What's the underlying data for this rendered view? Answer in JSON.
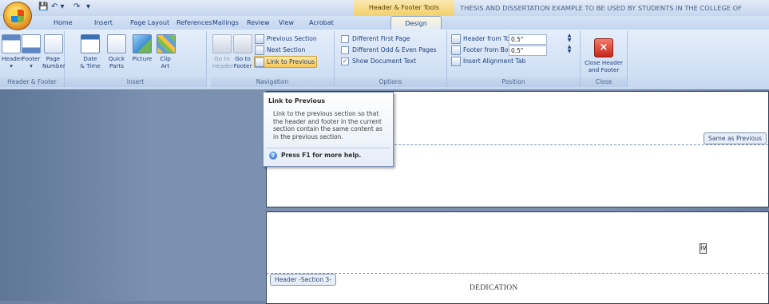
{
  "window": {
    "contextual_tab": "Header & Footer Tools",
    "document_title": "THESIS AND DISSERTATION EXAMPLE TO BE USED BY STUDENTS IN THE COLLEGE OF"
  },
  "qat": {
    "save": "💾",
    "undo": "↶ ▾",
    "redo": "↷",
    "dropdown": "▾"
  },
  "tabs": [
    "Home",
    "Insert",
    "Page Layout",
    "References",
    "Mailings",
    "Review",
    "View",
    "Acrobat",
    "Design"
  ],
  "groups": {
    "header_footer": {
      "label": "Header & Footer",
      "buttons": [
        "Header",
        "Footer",
        "Page",
        "Number"
      ]
    },
    "insert": {
      "label": "Insert",
      "buttons": [
        "Date",
        "& Time",
        "Quick",
        "Parts",
        "Picture",
        "Clip",
        "Art"
      ]
    },
    "navigation": {
      "label": "Navigation",
      "goto_header": [
        "Go to",
        "Header"
      ],
      "goto_footer": [
        "Go to",
        "Footer"
      ],
      "previous_section": "Previous Section",
      "next_section": "Next Section",
      "link_to_previous": "Link to Previous"
    },
    "options": {
      "label": "Options",
      "different_first_page": "Different First Page",
      "different_odd_even": "Different Odd & Even Pages",
      "show_document_text": "Show Document Text"
    },
    "position": {
      "label": "Position",
      "header_from_top": "Header from Top:",
      "header_from_top_value": "0.5\"",
      "footer_from_bottom": "Footer from Bottom:",
      "footer_from_bottom_value": "0.5\"",
      "insert_alignment_tab": "Insert Alignment Tab"
    },
    "close": {
      "label": "Close",
      "close_button": [
        "Close Header",
        "and Footer"
      ]
    }
  },
  "tooltip": {
    "title": "Link to Previous",
    "body": "Link to the previous section so that the header and footer in the current section contain the same content as in the previous section.",
    "help": "Press F1 for more help."
  },
  "document": {
    "same_as_previous": "Same as Previous",
    "header_section": "Header -Section 3-",
    "dedication": "DEDICATION",
    "page_number": "iv"
  }
}
